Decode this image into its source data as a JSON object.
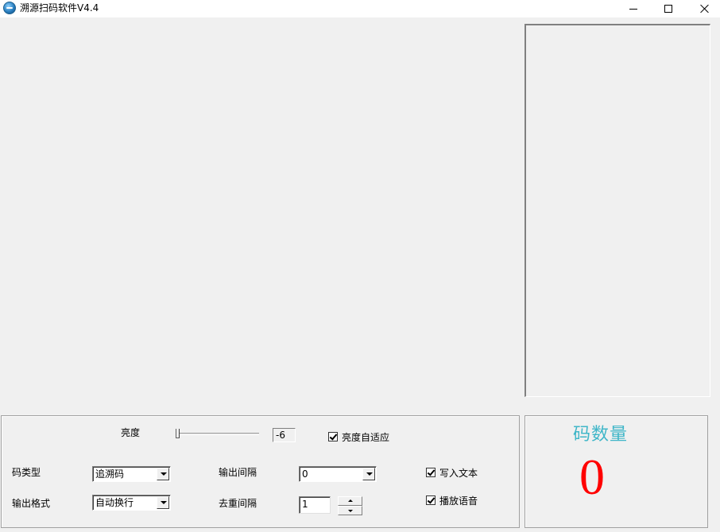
{
  "window": {
    "title": "溯源扫码软件V4.4",
    "icon": "app-globe-icon",
    "controls": [
      "minimize-icon",
      "maximize-icon",
      "close-icon"
    ]
  },
  "settings": {
    "brightness_label": "亮度",
    "brightness_value": "-6",
    "auto_brightness_label": "亮度自适应",
    "auto_brightness_checked": true,
    "code_type_label": "码类型",
    "code_type_value": "追溯码",
    "output_format_label": "输出格式",
    "output_format_value": "自动换行",
    "output_interval_label": "输出间隔",
    "output_interval_value": "0",
    "dedupe_interval_label": "去重间隔",
    "dedupe_interval_value": "1",
    "write_text_label": "写入文本",
    "write_text_checked": true,
    "play_voice_label": "播放语音",
    "play_voice_checked": true
  },
  "counter": {
    "title": "码数量",
    "value": "0",
    "title_color": "#3fb6c8",
    "value_color": "#ff0000"
  }
}
